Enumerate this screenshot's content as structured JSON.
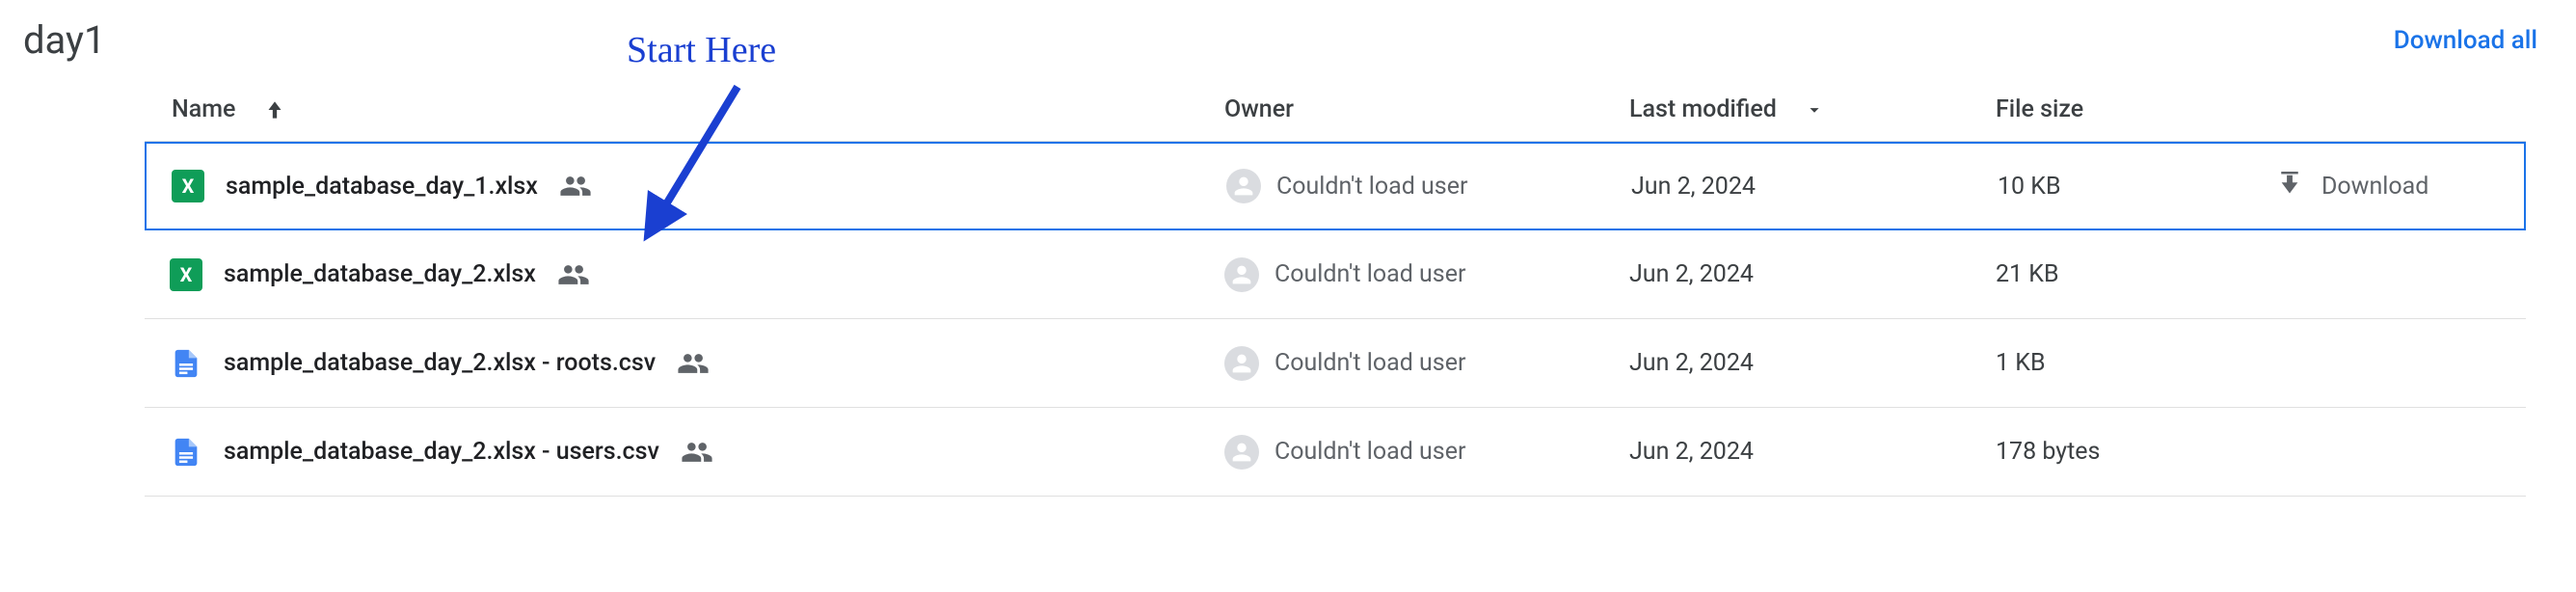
{
  "header": {
    "title": "day1",
    "download_all": "Download all"
  },
  "columns": {
    "name": "Name",
    "owner": "Owner",
    "lastmod": "Last modified",
    "size": "File size"
  },
  "owner_text": "Couldn't load user",
  "download_label": "Download",
  "annotation": "Start Here",
  "files": [
    {
      "name": "sample_database_day_1.xlsx",
      "type": "xlsx",
      "owner": "Couldn't load user",
      "modified": "Jun 2, 2024",
      "size": "10 KB",
      "shared": true,
      "selected": true
    },
    {
      "name": "sample_database_day_2.xlsx",
      "type": "xlsx",
      "owner": "Couldn't load user",
      "modified": "Jun 2, 2024",
      "size": "21 KB",
      "shared": true,
      "selected": false
    },
    {
      "name": "sample_database_day_2.xlsx - roots.csv",
      "type": "csv",
      "owner": "Couldn't load user",
      "modified": "Jun 2, 2024",
      "size": "1 KB",
      "shared": true,
      "selected": false
    },
    {
      "name": "sample_database_day_2.xlsx - users.csv",
      "type": "csv",
      "owner": "Couldn't load user",
      "modified": "Jun 2, 2024",
      "size": "178 bytes",
      "shared": true,
      "selected": false
    }
  ]
}
